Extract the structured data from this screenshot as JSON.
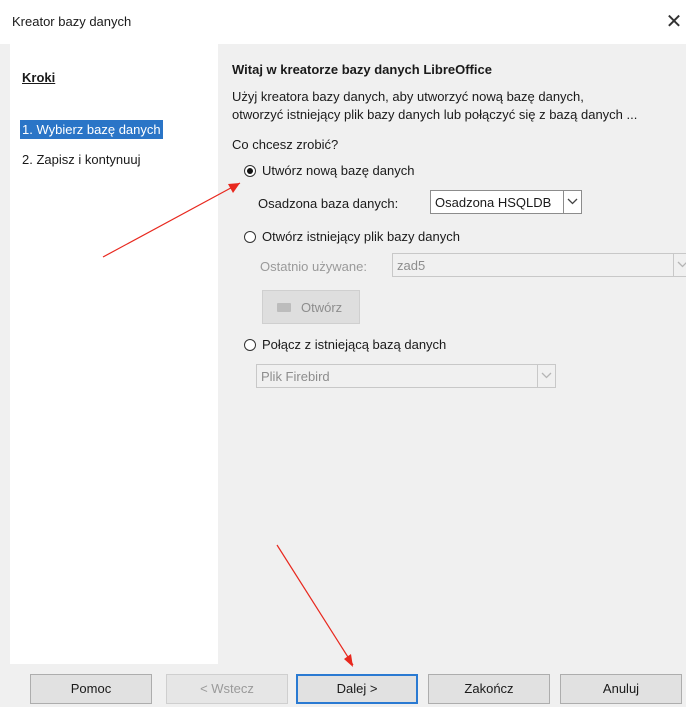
{
  "window": {
    "title": "Kreator bazy danych",
    "close_glyph": "✕"
  },
  "steps": {
    "title": "Kroki",
    "items": [
      {
        "label": "1. Wybierz bazę danych",
        "selected": true
      },
      {
        "label": "2. Zapisz i kontynuuj",
        "selected": false
      }
    ]
  },
  "main": {
    "heading": "Witaj w kreatorze bazy danych LibreOffice",
    "description_line1": "Użyj kreatora bazy danych, aby utworzyć nową bazę danych,",
    "description_line2": "otworzyć istniejący plik bazy danych lub połączyć się z bazą danych ...",
    "question": "Co chcesz zrobić?",
    "option_new": {
      "label": "Utwórz nową bazę danych",
      "checked": true
    },
    "embedded_label": "Osadzona baza danych:",
    "embedded_value": "Osadzona HSQLDB",
    "option_open": {
      "label": "Otwórz istniejący plik bazy danych",
      "checked": false
    },
    "recent_label": "Ostatnio używane:",
    "recent_value": "zad5",
    "open_button": "Otwórz",
    "option_connect": {
      "label": "Połącz z istniejącą bazą danych",
      "checked": false
    },
    "connect_value": "Plik Firebird"
  },
  "buttons": {
    "help": "Pomoc",
    "back": "< Wstecz",
    "next": "Dalej >",
    "finish": "Zakończ",
    "cancel": "Anuluj"
  },
  "colors": {
    "selection": "#2a75c7",
    "default_button_border": "#2a7ad2",
    "annotation_arrow": "#e8281e"
  },
  "icons": {
    "close": "close-icon",
    "dropdown": "chevron-down-icon",
    "folder": "folder-icon"
  }
}
